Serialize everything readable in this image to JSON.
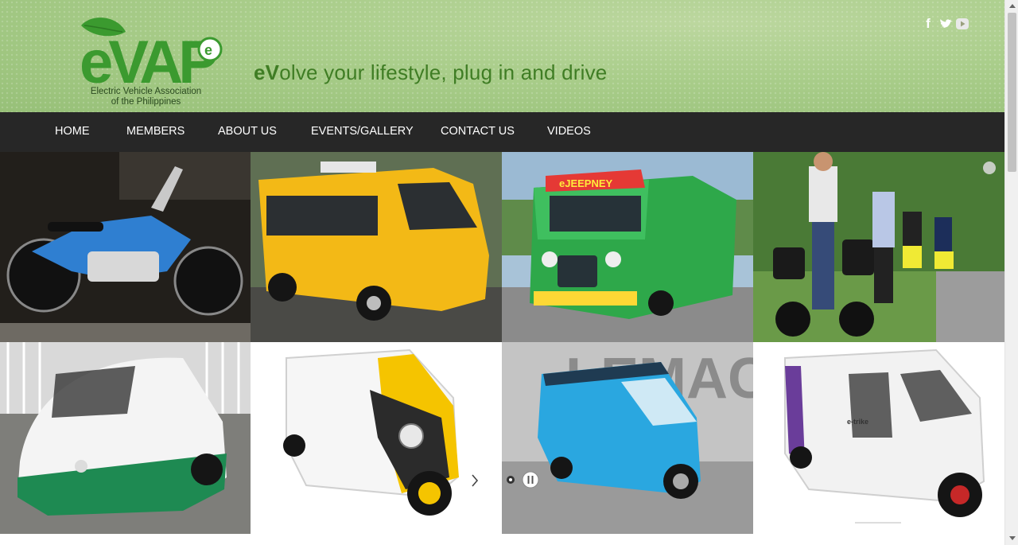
{
  "brand": {
    "logo_text": "eVAP",
    "logo_sub_line1": "Electric Vehicle Association",
    "logo_sub_line2": "of the Philippines"
  },
  "tagline": {
    "accent": "eV",
    "rest": "olve your lifestyle, plug in and drive"
  },
  "social": [
    {
      "icon": "facebook-icon",
      "label": "f"
    },
    {
      "icon": "twitter-icon",
      "label": ""
    },
    {
      "icon": "youtube-icon",
      "label": ""
    }
  ],
  "nav": {
    "home": "HOME",
    "members": "MEMBERS",
    "about": "ABOUT US",
    "events": "EVENTS/GALLERY",
    "contact": "CONTACT US",
    "videos": "VIDEOS"
  },
  "gallery": {
    "tiles": [
      {
        "name": "electric-motorcycle-photo",
        "text": ""
      },
      {
        "name": "yellow-electric-bus-photo",
        "text": ""
      },
      {
        "name": "ejeepney-photo",
        "text": "eJEEPNEY"
      },
      {
        "name": "segway-riders-photo",
        "text": ""
      },
      {
        "name": "green-white-etrike-photo",
        "text": ""
      },
      {
        "name": "yellow-etrike-photo",
        "text": ""
      },
      {
        "name": "blue-etrike-photo",
        "text": "LEMAC"
      },
      {
        "name": "white-etrike-photo",
        "text": "e-trike"
      }
    ],
    "controls": {
      "next_icon": "chevron-right-icon",
      "pause_icon": "pause-icon",
      "dot_icon": "slide-dot-icon"
    }
  },
  "colors": {
    "header_green": "#a9cd8a",
    "tagline_green": "#3f7d24",
    "nav_bg": "#272727",
    "logo_green": "#3b9a2f"
  }
}
